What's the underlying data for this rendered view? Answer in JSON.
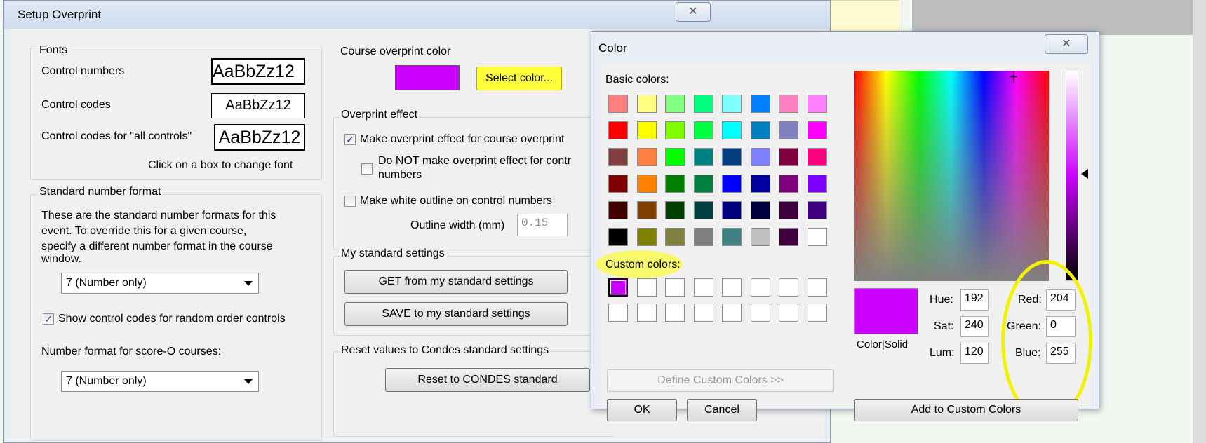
{
  "main_window": {
    "title": "Setup Overprint",
    "close_glyph": "✕"
  },
  "fonts": {
    "legend": "Fonts",
    "control_numbers_label": "Control numbers",
    "control_numbers_sample": "AaBbZz12",
    "control_codes_label": "Control codes",
    "control_codes_sample": "AaBbZz12",
    "all_controls_label": "Control codes for \"all controls\"",
    "all_controls_sample": "AaBbZz12",
    "hint": "Click on a box to change font"
  },
  "standard_number_format": {
    "legend": "Standard number format",
    "description": [
      "These are the standard number formats for this",
      "event.  To override this for a given course,",
      "specify a different number format in the course",
      "window."
    ],
    "format_value": "7  (Number only)",
    "show_codes_label": "Show control codes for random order controls",
    "show_codes_checked": true,
    "score_o_label": "Number format for score-O courses:",
    "score_o_value": "7  (Number only)"
  },
  "course_color": {
    "legend": "Course overprint color",
    "swatch_color": "#cc00ff",
    "select_button": "Select color..."
  },
  "overprint_effect": {
    "legend": "Overprint effect",
    "make_effect_label": "Make overprint effect for course overprint",
    "make_effect_checked": true,
    "do_not_label_line1": "Do NOT make overprint effect for contr",
    "do_not_label_line2": "numbers",
    "do_not_checked": false,
    "white_outline_label": "Make white outline on control numbers",
    "white_outline_checked": false,
    "outline_width_label": "Outline width (mm)",
    "outline_width_value": "0.15"
  },
  "my_settings": {
    "legend": "My standard settings",
    "get_button": "GET from my standard settings",
    "save_button": "SAVE to my standard settings"
  },
  "reset": {
    "legend": "Reset values to Condes standard settings",
    "button": "Reset to CONDES standard"
  },
  "color_dialog": {
    "title": "Color",
    "close_glyph": "✕",
    "basic_label": "Basic colors:",
    "basic_colors": [
      "#ff8080",
      "#ffff80",
      "#80ff80",
      "#00ff80",
      "#80ffff",
      "#0080ff",
      "#ff80c0",
      "#ff80ff",
      "#ff0000",
      "#ffff00",
      "#80ff00",
      "#00ff40",
      "#00ffff",
      "#0080c0",
      "#8080c0",
      "#ff00ff",
      "#804040",
      "#ff8040",
      "#00ff00",
      "#008080",
      "#004080",
      "#8080ff",
      "#800040",
      "#ff0080",
      "#800000",
      "#ff8000",
      "#008000",
      "#008040",
      "#0000ff",
      "#0000a0",
      "#800080",
      "#8000ff",
      "#400000",
      "#804000",
      "#004000",
      "#004040",
      "#000080",
      "#000040",
      "#400040",
      "#400080",
      "#000000",
      "#808000",
      "#808040",
      "#808080",
      "#408080",
      "#c0c0c0",
      "#400040",
      "#ffffff"
    ],
    "custom_label": "Custom colors:",
    "custom_colors": [
      "#cc00ff",
      "#ffffff",
      "#ffffff",
      "#ffffff",
      "#ffffff",
      "#ffffff",
      "#ffffff",
      "#ffffff",
      "#ffffff",
      "#ffffff",
      "#ffffff",
      "#ffffff",
      "#ffffff",
      "#ffffff",
      "#ffffff",
      "#ffffff"
    ],
    "define_button": "Define Custom Colors >>",
    "ok_button": "OK",
    "cancel_button": "Cancel",
    "preview_color": "#cc00ff",
    "preview_label": "Color|Solid",
    "hue_label": "Hue:",
    "hue_value": "192",
    "sat_label": "Sat:",
    "sat_value": "240",
    "lum_label": "Lum:",
    "lum_value": "120",
    "red_label": "Red:",
    "red_value": "204",
    "green_label": "Green:",
    "green_value": "0",
    "blue_label": "Blue:",
    "blue_value": "255",
    "add_button": "Add to Custom Colors"
  }
}
